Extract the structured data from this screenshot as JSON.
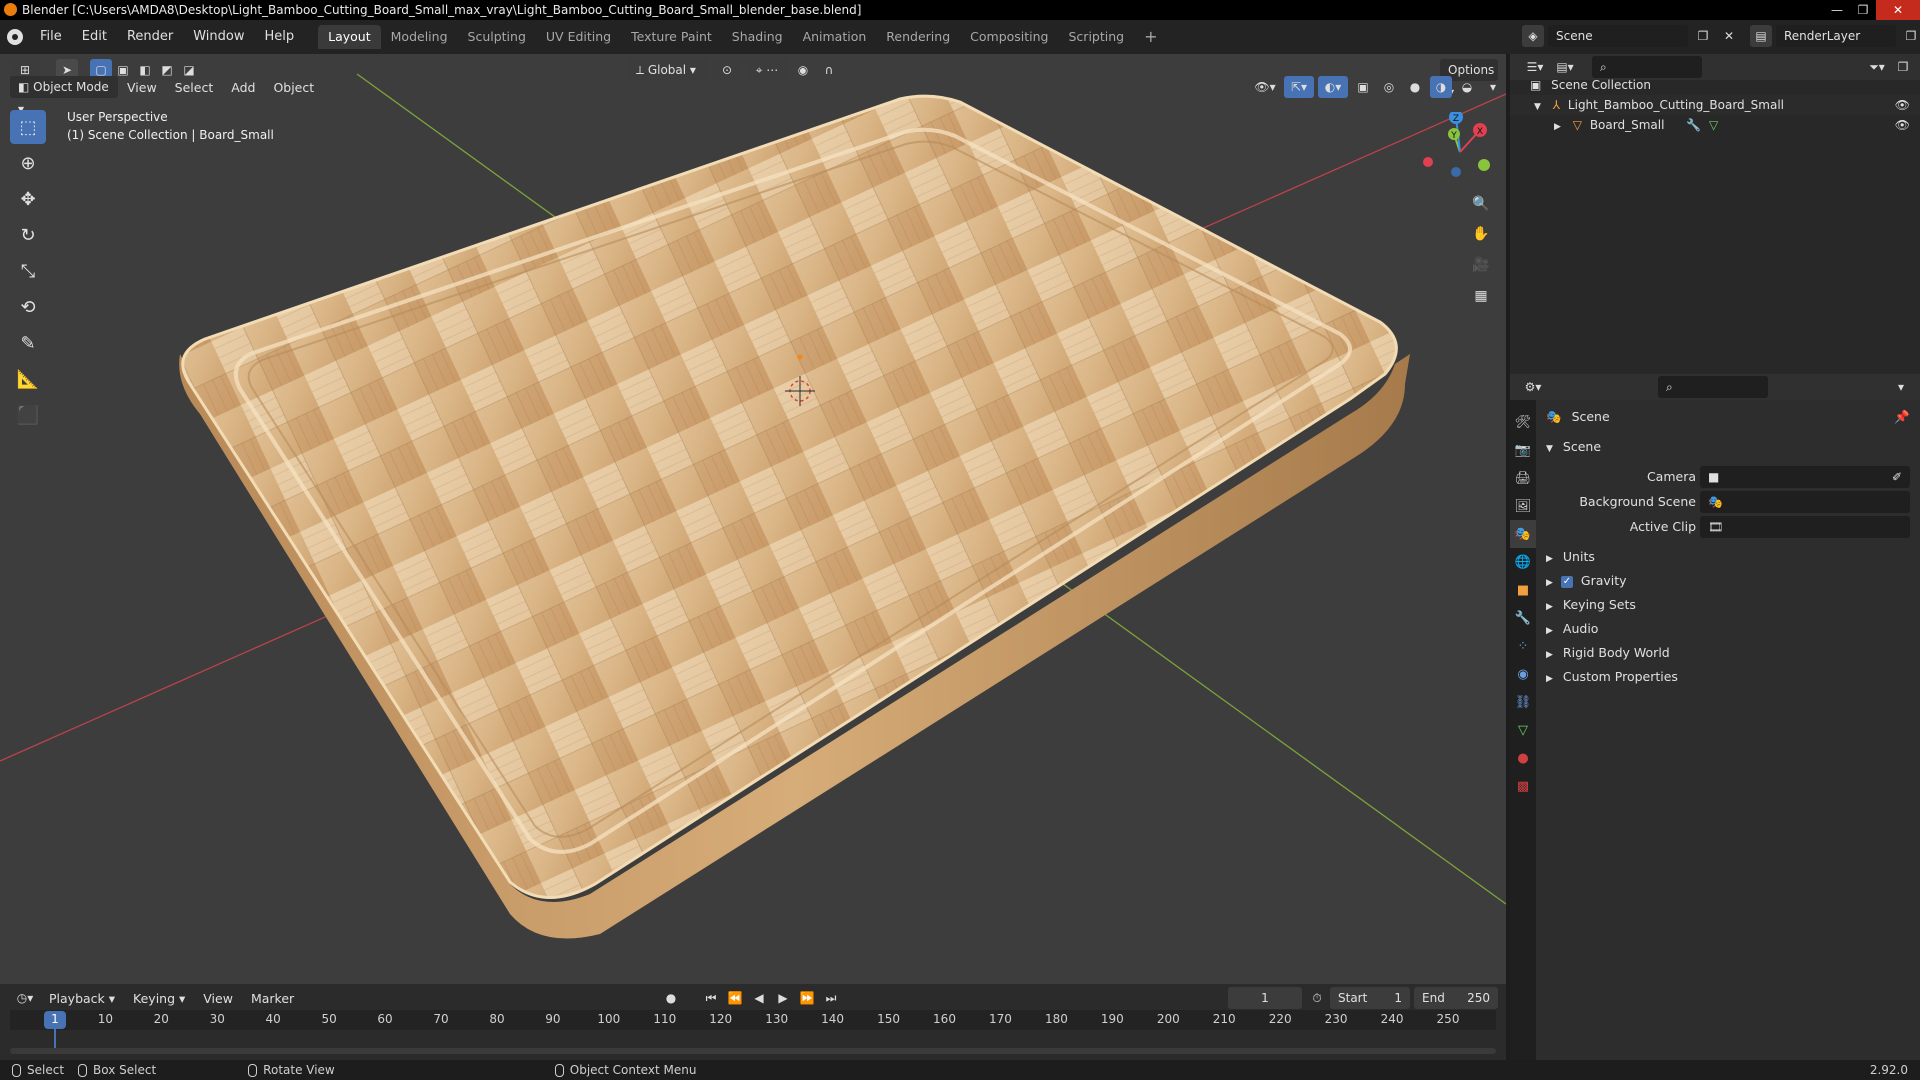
{
  "window": {
    "title": "Blender [C:\\Users\\AMDA8\\Desktop\\Light_Bamboo_Cutting_Board_Small_max_vray\\Light_Bamboo_Cutting_Board_Small_blender_base.blend]",
    "controls": [
      "—",
      "❐",
      "✕"
    ]
  },
  "menu": [
    "File",
    "Edit",
    "Render",
    "Window",
    "Help"
  ],
  "workspaces": [
    "Layout",
    "Modeling",
    "Sculpting",
    "UV Editing",
    "Texture Paint",
    "Shading",
    "Animation",
    "Rendering",
    "Compositing",
    "Scripting"
  ],
  "active_workspace": "Layout",
  "scene_name": "Scene",
  "render_layer": "RenderLayer",
  "viewport": {
    "mode": "Object Mode",
    "menus": [
      "View",
      "Select",
      "Add",
      "Object"
    ],
    "transform_orientation": "Global",
    "options_label": "Options",
    "info_line1": "User Perspective",
    "info_line2": "(1) Scene Collection | Board_Small",
    "gizmo_axes": {
      "x": "X",
      "y": "Y",
      "z": "Z"
    }
  },
  "outliner": {
    "root": "Scene Collection",
    "collection": "Light_Bamboo_Cutting_Board_Small",
    "object": "Board_Small"
  },
  "properties": {
    "context": "Scene",
    "section": "Scene",
    "fields": [
      {
        "label": "Camera",
        "value": ""
      },
      {
        "label": "Background Scene",
        "value": ""
      },
      {
        "label": "Active Clip",
        "value": ""
      }
    ],
    "panels": [
      "Units",
      "Gravity",
      "Keying Sets",
      "Audio",
      "Rigid Body World",
      "Custom Properties"
    ],
    "gravity_enabled": true
  },
  "timeline": {
    "menus": [
      "Playback",
      "Keying",
      "View",
      "Marker"
    ],
    "current_frame": "1",
    "start_label": "Start",
    "start": "1",
    "end_label": "End",
    "end": "250",
    "ticks": [
      "1",
      "10",
      "20",
      "30",
      "40",
      "50",
      "60",
      "70",
      "80",
      "90",
      "100",
      "110",
      "120",
      "130",
      "140",
      "150",
      "160",
      "170",
      "180",
      "190",
      "200",
      "210",
      "220",
      "230",
      "240",
      "250"
    ]
  },
  "statusbar": {
    "select": "Select",
    "box_select": "Box Select",
    "rotate_view": "Rotate View",
    "context_menu": "Object Context Menu",
    "version": "2.92.0"
  },
  "colors": {
    "accent": "#4772b3",
    "x_axis": "#e04050",
    "y_axis": "#8ac33e",
    "z_axis": "#3a8fe0",
    "viewport_bg": "#3d3d3d"
  }
}
